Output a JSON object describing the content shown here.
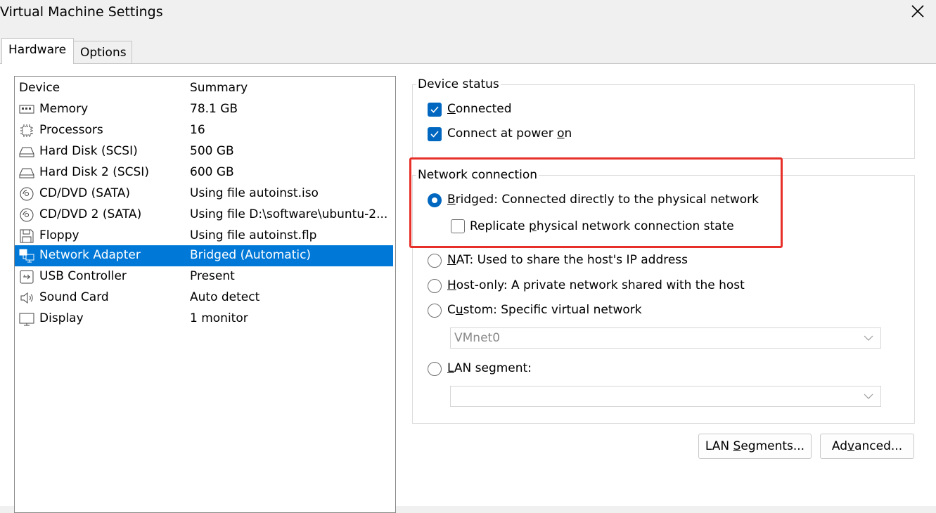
{
  "window": {
    "title": "Virtual Machine Settings",
    "close_icon": "close-icon"
  },
  "tabs": [
    {
      "label": "Hardware",
      "active": true
    },
    {
      "label": "Options",
      "active": false
    }
  ],
  "device_list": {
    "columns": {
      "device": "Device",
      "summary": "Summary"
    },
    "rows": [
      {
        "device": "Memory",
        "summary": "78.1 GB",
        "icon": "memory-icon"
      },
      {
        "device": "Processors",
        "summary": "16",
        "icon": "processor-icon"
      },
      {
        "device": "Hard Disk (SCSI)",
        "summary": "500 GB",
        "icon": "hard-disk-icon"
      },
      {
        "device": "Hard Disk 2 (SCSI)",
        "summary": "600 GB",
        "icon": "hard-disk-icon"
      },
      {
        "device": "CD/DVD (SATA)",
        "summary": "Using file autoinst.iso",
        "icon": "cd-dvd-icon"
      },
      {
        "device": "CD/DVD 2 (SATA)",
        "summary": "Using file D:\\software\\ubuntu-2...",
        "icon": "cd-dvd-icon"
      },
      {
        "device": "Floppy",
        "summary": "Using file autoinst.flp",
        "icon": "floppy-icon"
      },
      {
        "device": "Network Adapter",
        "summary": "Bridged (Automatic)",
        "icon": "network-adapter-icon",
        "selected": true
      },
      {
        "device": "USB Controller",
        "summary": "Present",
        "icon": "usb-icon"
      },
      {
        "device": "Sound Card",
        "summary": "Auto detect",
        "icon": "speaker-icon"
      },
      {
        "device": "Display",
        "summary": "1 monitor",
        "icon": "monitor-icon"
      }
    ]
  },
  "device_status": {
    "label": "Device status",
    "connected": {
      "accel": "C",
      "rest": "onnected",
      "checked": true
    },
    "connect_at_power_on": {
      "pre": "Connect at power ",
      "accel": "o",
      "post": "n",
      "checked": true
    }
  },
  "network_connection": {
    "label": "Network connection",
    "bridged": {
      "accel": "B",
      "rest": "ridged: Connected directly to the physical network",
      "selected": true
    },
    "replicate": {
      "pre": "Replicate ",
      "accel": "p",
      "post": "hysical network connection state",
      "checked": false
    },
    "nat": {
      "accel": "N",
      "rest": "AT: Used to share the host's IP address",
      "selected": false
    },
    "host_only": {
      "accel": "H",
      "rest": "ost-only: A private network shared with the host",
      "selected": false
    },
    "custom": {
      "pre": "C",
      "accel": "u",
      "post": "stom: Specific virtual network",
      "selected": false
    },
    "custom_network_value": "VMnet0",
    "lan_segment": {
      "accel": "L",
      "rest": "AN segment:",
      "selected": false
    },
    "lan_segment_value": ""
  },
  "buttons": {
    "lan_segments": {
      "pre": "LAN ",
      "accel": "S",
      "post": "egments..."
    },
    "advanced": {
      "pre": "Ad",
      "accel": "v",
      "post": "anced..."
    }
  },
  "colors": {
    "selection": "#0078d7",
    "accent": "#0067c0",
    "highlight": "#e8302a"
  }
}
